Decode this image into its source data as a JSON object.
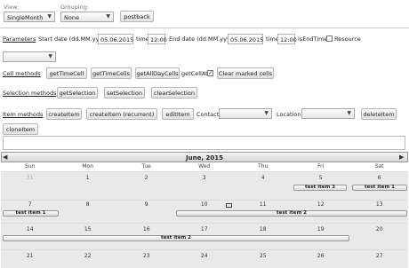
{
  "toolbar": {
    "view_label": "View:",
    "grouping_label": "Grouping:",
    "view_value": "SingleMonth",
    "grouping_value": "None",
    "postback_label": "postback"
  },
  "params": {
    "title": "Parameters",
    "start_label": "Start date (dd.MM.yyyy)",
    "start_date": "05.06.2015",
    "start_time_label": "time",
    "start_time": "12:00",
    "end_label": "End date (dd.MM.yyyy)",
    "end_date": "05.06.2015",
    "end_time_label": "time",
    "end_time": "12:00",
    "is_end_time_label": "isEndTime",
    "resource_label": "Resource"
  },
  "cell_methods": {
    "title": "Cell methods",
    "buttons": [
      "getTimeCell",
      "getTimeCells",
      "getAllDayCells"
    ],
    "getcellat_label": "getCellAt",
    "clear_label": "Clear marked cells"
  },
  "selection_methods": {
    "title": "Selection methods",
    "buttons": [
      "getSelection",
      "setSelection",
      "clearSelection"
    ]
  },
  "item_methods": {
    "title": "Item methods",
    "create_item": "createItem",
    "create_recurrent": "createItem (recurrent)",
    "edit_item": "editItem",
    "contact_label": "Contact",
    "location_label": "Location",
    "delete_item": "deleteItem",
    "clone_item": "cloneItem"
  },
  "calendar": {
    "title": "June, 2015",
    "prev_icon": "triangle-left",
    "next_icon": "triangle-right",
    "days": [
      "Sun",
      "Mon",
      "Tue",
      "Wed",
      "Thu",
      "Fri",
      "Sat"
    ],
    "weeks": [
      [
        "31",
        "1",
        "2",
        "3",
        "4",
        "5",
        "6"
      ],
      [
        "7",
        "8",
        "9",
        "10",
        "11",
        "12",
        "13"
      ],
      [
        "14",
        "15",
        "16",
        "17",
        "18",
        "19",
        "20"
      ],
      [
        "21",
        "22",
        "23",
        "24",
        "25",
        "26",
        "27"
      ]
    ],
    "events": {
      "item3": "test item 3",
      "item1_a": "test item 1",
      "item1_b": "test item 1",
      "item2_a": "test item 2",
      "item2_b": "test item 2"
    }
  }
}
